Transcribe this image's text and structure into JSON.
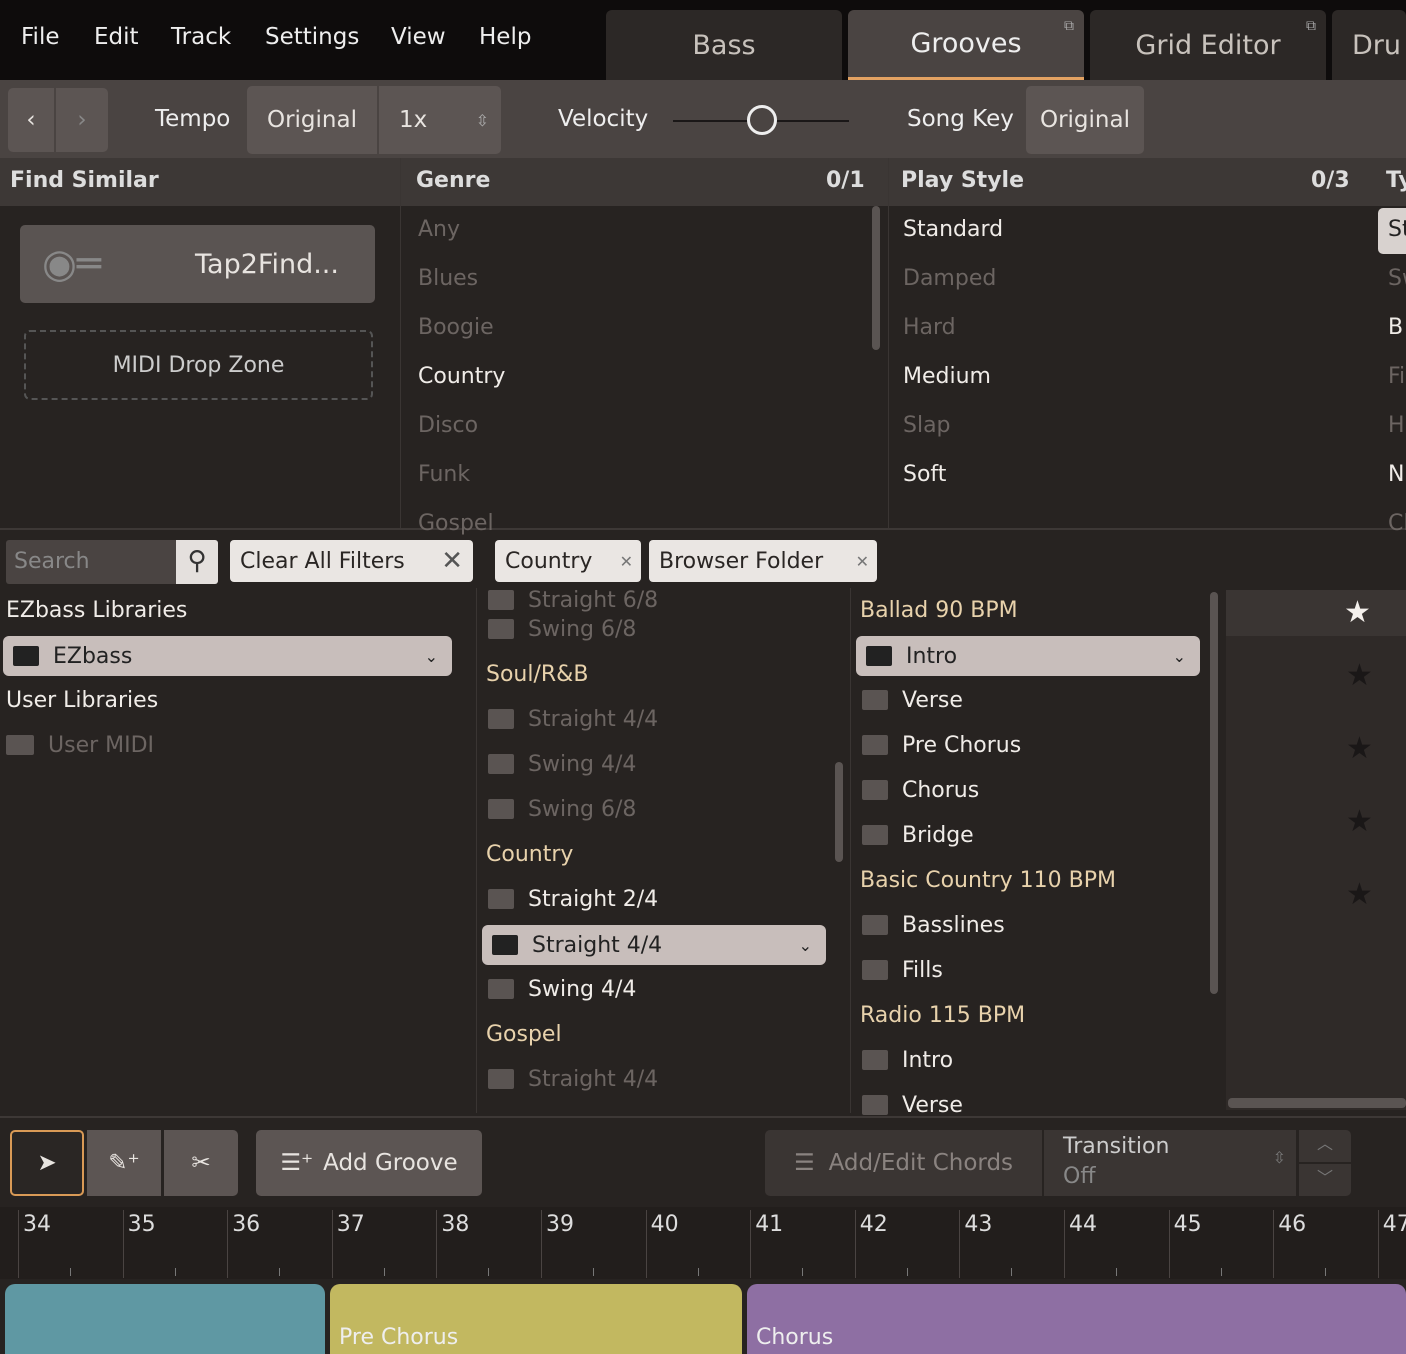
{
  "menu": [
    "File",
    "Edit",
    "Track",
    "Settings",
    "View",
    "Help"
  ],
  "tabs": [
    {
      "label": "Bass"
    },
    {
      "label": "Grooves",
      "active": true
    },
    {
      "label": "Grid Editor"
    },
    {
      "label": "Dru"
    }
  ],
  "toolbar": {
    "tempo_label": "Tempo",
    "tempo_value": "Original",
    "tempo_mult": "1x",
    "velocity_label": "Velocity",
    "velocity_level": 0.5,
    "song_key_label": "Song Key",
    "song_key_value": "Original"
  },
  "filters": {
    "find_similar": {
      "title": "Find Similar",
      "tap2find": "Tap2Find...",
      "midi_drop": "MIDI Drop Zone"
    },
    "genre": {
      "title": "Genre",
      "count": "0/1",
      "items": [
        {
          "label": "Any",
          "on": false
        },
        {
          "label": "Blues",
          "on": false
        },
        {
          "label": "Boogie",
          "on": false
        },
        {
          "label": "Country",
          "on": true
        },
        {
          "label": "Disco",
          "on": false
        },
        {
          "label": "Funk",
          "on": false
        },
        {
          "label": "Gospel",
          "on": false
        }
      ]
    },
    "play_style": {
      "title": "Play Style",
      "count": "0/3",
      "items": [
        {
          "label": "Standard",
          "on": true
        },
        {
          "label": "Damped",
          "on": false
        },
        {
          "label": "Hard",
          "on": false
        },
        {
          "label": "Medium",
          "on": true
        },
        {
          "label": "Slap",
          "on": false
        },
        {
          "label": "Soft",
          "on": true
        }
      ]
    },
    "type": {
      "title": "Ty",
      "items": [
        "St",
        "Sw",
        "B",
        "Fi",
        "H",
        "N",
        "Cl"
      ]
    }
  },
  "search": {
    "placeholder": "Search",
    "clear_all": "Clear All Filters",
    "chips": [
      "Country",
      "Browser Folder"
    ]
  },
  "libraries": {
    "ezbass_title": "EZbass Libraries",
    "ezbass_selected": "EZbass",
    "user_title": "User Libraries",
    "user_midi": "User MIDI"
  },
  "folders": [
    {
      "label": "Straight 6/8",
      "type": "item",
      "on": false
    },
    {
      "label": "Swing 6/8",
      "type": "item",
      "on": false
    },
    {
      "label": "Soul/R&B",
      "type": "header"
    },
    {
      "label": "Straight 4/4",
      "type": "item",
      "on": false
    },
    {
      "label": "Swing 4/4",
      "type": "item",
      "on": false
    },
    {
      "label": "Swing 6/8",
      "type": "item",
      "on": false
    },
    {
      "label": "Country",
      "type": "header"
    },
    {
      "label": "Straight 2/4",
      "type": "item",
      "on": true
    },
    {
      "label": "Straight 4/4",
      "type": "selected"
    },
    {
      "label": "Swing 4/4",
      "type": "item",
      "on": true
    },
    {
      "label": "Gospel",
      "type": "header"
    },
    {
      "label": "Straight 4/4",
      "type": "item",
      "on": false
    }
  ],
  "grooves": [
    {
      "label": "Ballad 90 BPM",
      "type": "header"
    },
    {
      "label": "Intro",
      "type": "selected"
    },
    {
      "label": "Verse",
      "type": "item"
    },
    {
      "label": "Pre Chorus",
      "type": "item"
    },
    {
      "label": "Chorus",
      "type": "item"
    },
    {
      "label": "Bridge",
      "type": "item"
    },
    {
      "label": "Basic Country 110 BPM",
      "type": "header"
    },
    {
      "label": "Basslines",
      "type": "item"
    },
    {
      "label": "Fills",
      "type": "item"
    },
    {
      "label": "Radio 115 BPM",
      "type": "header"
    },
    {
      "label": "Intro",
      "type": "item"
    },
    {
      "label": "Verse",
      "type": "item"
    }
  ],
  "bottom": {
    "add_groove": "Add Groove",
    "add_edit_chords": "Add/Edit Chords",
    "transition_label": "Transition",
    "transition_value": "Off"
  },
  "ruler": [
    "34",
    "35",
    "36",
    "37",
    "38",
    "39",
    "40",
    "41",
    "42",
    "43",
    "44",
    "45",
    "46",
    "47"
  ],
  "song_parts": [
    {
      "label": "",
      "color": "#5f98a3"
    },
    {
      "label": "Pre Chorus",
      "color": "#c2b860"
    },
    {
      "label": "Chorus",
      "color": "#8e6fa3"
    }
  ]
}
